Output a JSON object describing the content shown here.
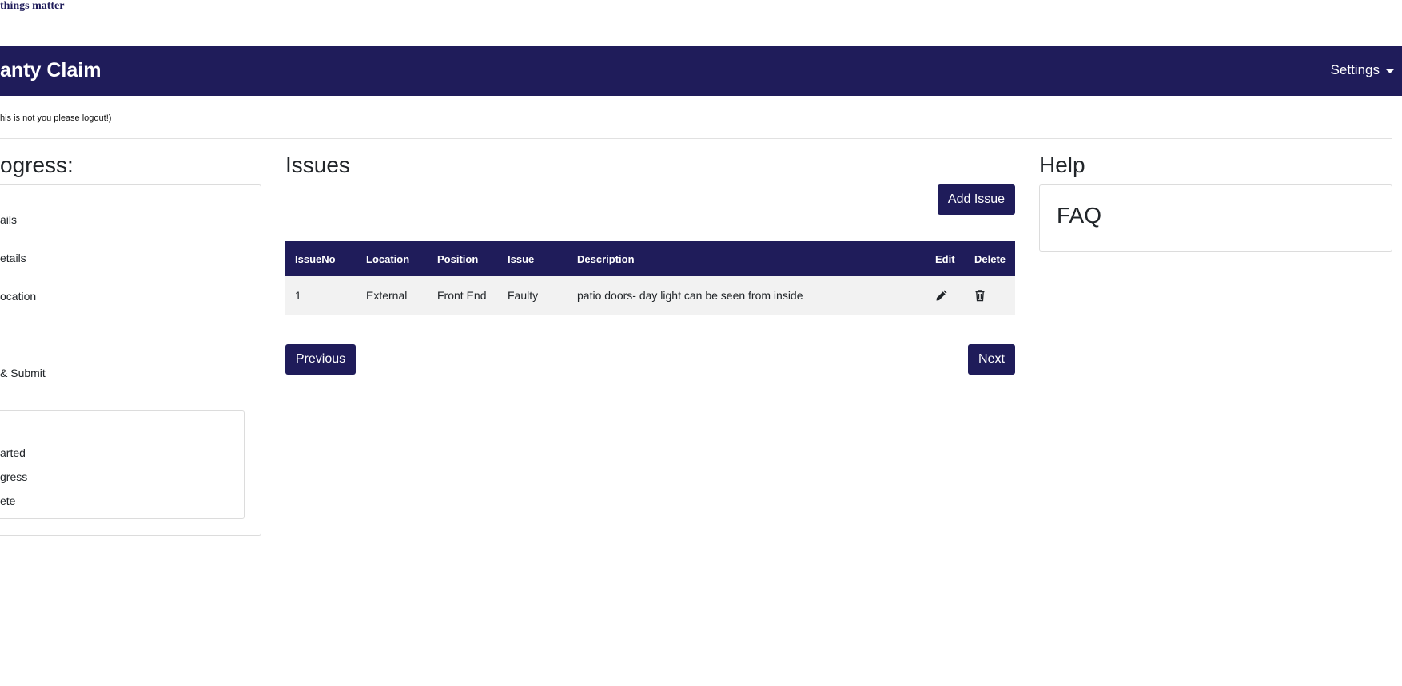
{
  "brand": {
    "tagline": "things matter"
  },
  "navbar": {
    "title": "anty Claim",
    "settings_label": "Settings"
  },
  "notice": "his is not you please logout!)",
  "progress": {
    "heading": "ogress:",
    "steps": [
      {
        "label": "ails"
      },
      {
        "label": "etails"
      },
      {
        "label": "ocation"
      },
      {
        "label": "& Submit"
      }
    ],
    "legend": [
      {
        "label": "arted"
      },
      {
        "label": "gress"
      },
      {
        "label": "ete"
      }
    ]
  },
  "issues": {
    "heading": "Issues",
    "add_label": "Add Issue",
    "columns": [
      "IssueNo",
      "Location",
      "Position",
      "Issue",
      "Description",
      "Edit",
      "Delete"
    ],
    "rows": [
      {
        "no": "1",
        "location": "External",
        "position": "Front End",
        "issue": "Faulty",
        "description": "patio doors- day light can be seen from inside",
        "edit_icon": "pencil-icon",
        "delete_icon": "trash-icon"
      }
    ],
    "previous_label": "Previous",
    "next_label": "Next"
  },
  "help": {
    "heading": "Help",
    "faq_label": "FAQ"
  },
  "colors": {
    "brand": "#1f1c5a",
    "row_bg": "#f2f2f2",
    "border": "#dcdcdc"
  }
}
